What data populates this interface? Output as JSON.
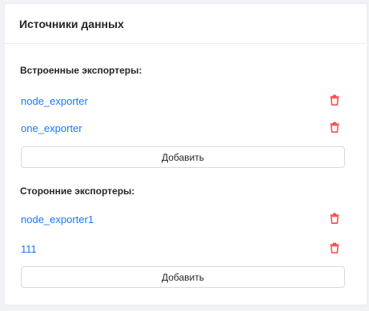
{
  "card": {
    "title": "Источники данных"
  },
  "builtin": {
    "title": "Встроенные экспортеры:",
    "items": [
      {
        "label": "node_exporter"
      },
      {
        "label": "one_exporter"
      }
    ],
    "add_label": "Добавить"
  },
  "thirdparty": {
    "title": "Сторонние экспортеры:",
    "items": [
      {
        "label": "node_exporter1"
      },
      {
        "label": "111"
      }
    ],
    "add_label": "Добавить"
  },
  "icons": {
    "delete": "trash-icon"
  },
  "colors": {
    "link": "#1677ff",
    "danger": "#ff4d4f"
  }
}
